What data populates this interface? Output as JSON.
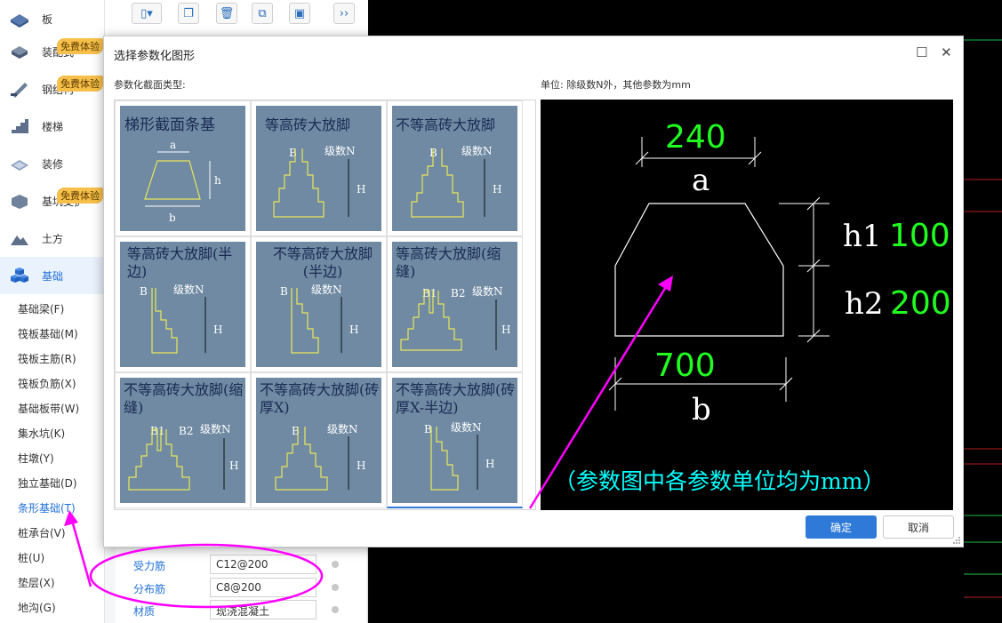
{
  "sidebar": {
    "categories": [
      {
        "label": "板",
        "icon": "slab-icon"
      },
      {
        "label": "装配式",
        "icon": "prefab-icon",
        "badge": "免费体验"
      },
      {
        "label": "钢结构",
        "icon": "steel-icon",
        "badge": "免费体验"
      },
      {
        "label": "楼梯",
        "icon": "stairs-icon"
      },
      {
        "label": "装修",
        "icon": "decoration-icon"
      },
      {
        "label": "基坑支护",
        "icon": "pit-support-icon",
        "badge": "免费体验"
      },
      {
        "label": "土方",
        "icon": "earthwork-icon"
      },
      {
        "label": "基础",
        "icon": "foundation-icon"
      }
    ],
    "sub_items": [
      "基础梁(F)",
      "筏板基础(M)",
      "筏板主筋(R)",
      "筏板负筋(X)",
      "基础板带(W)",
      "集水坑(K)",
      "柱墩(Y)",
      "独立基础(D)",
      "条形基础(T)",
      "桩承台(V)",
      "桩(U)",
      "垫层(X)",
      "地沟(G)"
    ],
    "active_sub": "条形基础(T)"
  },
  "properties": [
    {
      "name": "受力筋",
      "value": "C12@200"
    },
    {
      "name": "分布筋",
      "value": "C8@200"
    },
    {
      "name": "材质",
      "value": "现浇混凝土"
    }
  ],
  "dialog": {
    "title": "选择参数化图形",
    "type_label": "参数化截面类型:",
    "unit_label": "单位:   除级数N外，其他参数为mm",
    "ok_label": "确定",
    "cancel_label": "取消",
    "shapes": [
      {
        "title": "梯形截面条基",
        "kind": "trapezoid"
      },
      {
        "title": "等高砖大放脚",
        "kind": "step-sym",
        "labels": [
          "B",
          "级数N",
          "H"
        ]
      },
      {
        "title": "不等高砖大放脚",
        "kind": "step-sym",
        "labels": [
          "B",
          "级数N",
          "H"
        ]
      },
      {
        "title": "等高砖大放脚(半边)",
        "kind": "step-half",
        "labels": [
          "B",
          "级数N",
          "H"
        ]
      },
      {
        "title": "不等高砖大放脚(半边)",
        "kind": "step-half",
        "labels": [
          "B",
          "级数N",
          "H"
        ]
      },
      {
        "title": "等高砖大放脚(缩缝)",
        "kind": "step-gap",
        "labels": [
          "B1",
          "B2",
          "级数N",
          "H"
        ]
      },
      {
        "title": "不等高砖大放脚(缩缝)",
        "kind": "step-gap",
        "labels": [
          "B1",
          "B2",
          "级数N",
          "H"
        ]
      },
      {
        "title": "不等高砖大放脚(砖厚X)",
        "kind": "step-sym",
        "labels": [
          "B",
          "级数N",
          "H"
        ]
      },
      {
        "title": "不等高砖大放脚(砖厚X-半边)",
        "kind": "step-half",
        "labels": [
          "B",
          "级数N",
          "H"
        ]
      }
    ],
    "preview": {
      "a_value": "240",
      "a_label": "a",
      "h1_label": "h1",
      "h1_value": "100",
      "h2_label": "h2",
      "h2_value": "200",
      "b_value": "700",
      "b_label": "b",
      "note": "（参数图中各参数单位均为mm）"
    }
  },
  "colors": {
    "accent": "#2f7ad8",
    "annotation": "#ff00ff",
    "cad_green": "#20ff20",
    "cad_cyan": "#00ffff",
    "card_bg": "#6f8aa2",
    "card_line": "#e8e85a"
  }
}
